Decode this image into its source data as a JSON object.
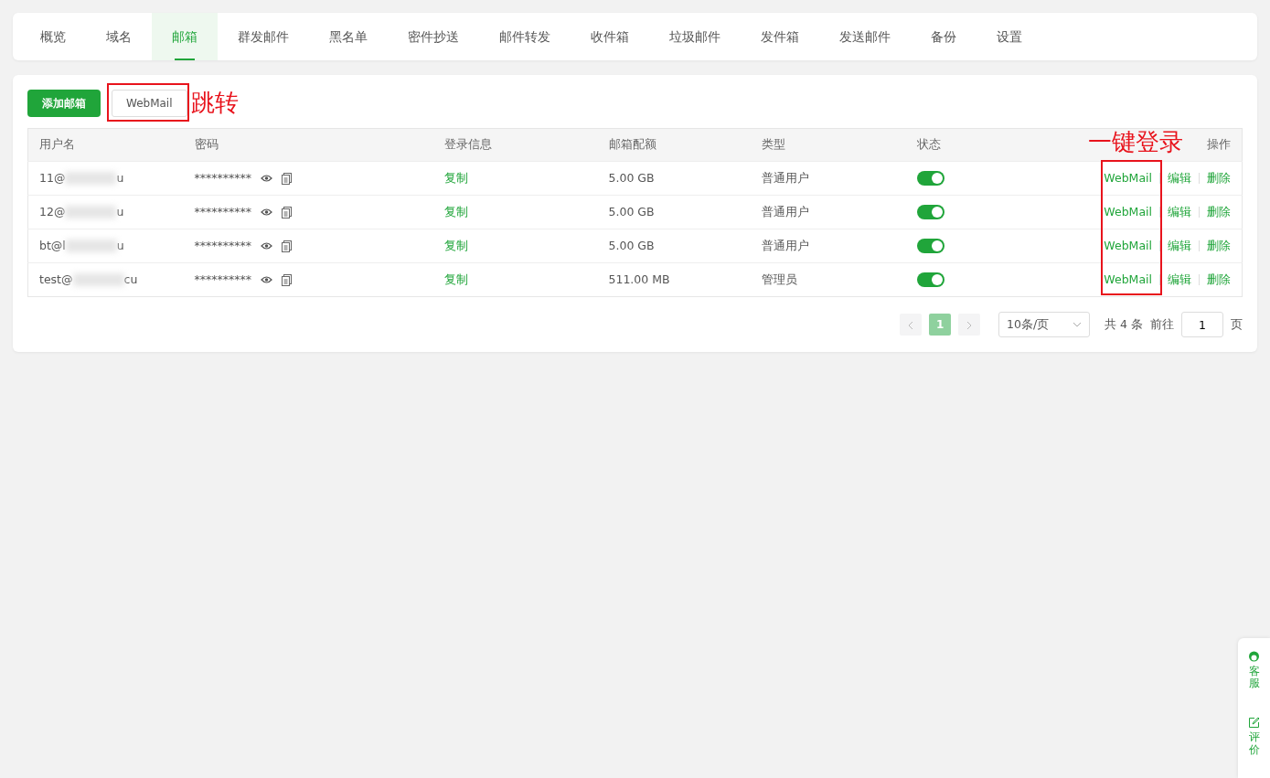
{
  "tabs": [
    {
      "label": "概览",
      "selected": false
    },
    {
      "label": "域名",
      "selected": false
    },
    {
      "label": "邮箱",
      "selected": true
    },
    {
      "label": "群发邮件",
      "selected": false
    },
    {
      "label": "黑名单",
      "selected": false
    },
    {
      "label": "密件抄送",
      "selected": false
    },
    {
      "label": "邮件转发",
      "selected": false
    },
    {
      "label": "收件箱",
      "selected": false
    },
    {
      "label": "垃圾邮件",
      "selected": false
    },
    {
      "label": "发件箱",
      "selected": false
    },
    {
      "label": "发送邮件",
      "selected": false
    },
    {
      "label": "备份",
      "selected": false
    },
    {
      "label": "设置",
      "selected": false
    }
  ],
  "toolbar": {
    "add_button": "添加邮箱",
    "webmail_button": "WebMail"
  },
  "table": {
    "columns": [
      "用户名",
      "密码",
      "登录信息",
      "邮箱配额",
      "类型",
      "状态",
      "操作"
    ],
    "rows": [
      {
        "username_start": "11@",
        "username_end": "u",
        "password": "**********",
        "login_info": "复制",
        "quota": "5.00 GB",
        "type": "普通用户",
        "status_on": true,
        "actions": [
          "WebMail",
          "编辑",
          "删除"
        ]
      },
      {
        "username_start": "12@",
        "username_end": "u",
        "password": "**********",
        "login_info": "复制",
        "quota": "5.00 GB",
        "type": "普通用户",
        "status_on": true,
        "actions": [
          "WebMail",
          "编辑",
          "删除"
        ]
      },
      {
        "username_start": "bt@l",
        "username_end": "u",
        "password": "**********",
        "login_info": "复制",
        "quota": "5.00 GB",
        "type": "普通用户",
        "status_on": true,
        "actions": [
          "WebMail",
          "编辑",
          "删除"
        ]
      },
      {
        "username_start": "test@",
        "username_end": "cu",
        "password": "**********",
        "login_info": "复制",
        "quota": "511.00 MB",
        "type": "管理员",
        "status_on": true,
        "actions": [
          "WebMail",
          "编辑",
          "删除"
        ]
      }
    ]
  },
  "pagination": {
    "pages": [
      {
        "label": "1",
        "selected": true
      }
    ],
    "page_size": "10条/页",
    "total": "共 4 条",
    "goto_label": "前往",
    "goto_value": "1",
    "page_unit": "页"
  },
  "annotations": [
    {
      "kind": "jump",
      "text": "跳转"
    },
    {
      "kind": "login",
      "text": "一键登录"
    }
  ],
  "side_widget": [
    {
      "kind": "service",
      "label": "客服"
    },
    {
      "kind": "review",
      "label": "评价"
    }
  ]
}
